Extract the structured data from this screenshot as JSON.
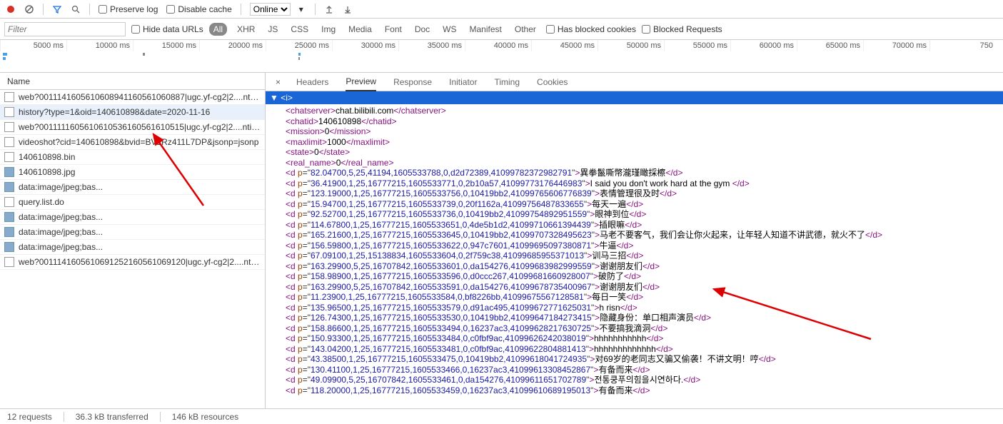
{
  "toolbar": {
    "preserve_log_label": "Preserve log",
    "disable_cache_label": "Disable cache",
    "throttle_value": "Online"
  },
  "filter": {
    "placeholder": "Filter",
    "hide_data_urls_label": "Hide data URLs",
    "all_label": "All",
    "types": [
      "XHR",
      "JS",
      "CSS",
      "Img",
      "Media",
      "Font",
      "Doc",
      "WS",
      "Manifest",
      "Other"
    ],
    "blocked_cookies_label": "Has blocked cookies",
    "blocked_requests_label": "Blocked Requests"
  },
  "timeline_ticks": [
    "5000 ms",
    "10000 ms",
    "15000 ms",
    "20000 ms",
    "25000 ms",
    "30000 ms",
    "35000 ms",
    "40000 ms",
    "45000 ms",
    "50000 ms",
    "55000 ms",
    "60000 ms",
    "65000 ms",
    "70000 ms",
    "750"
  ],
  "left_header": "Name",
  "requests": [
    {
      "name": "web?0011141605610608941160561060887|ugc.yf-cg2|2....ntin...",
      "kind": "doc"
    },
    {
      "name": "history?type=1&oid=140610898&date=2020-11-16",
      "kind": "doc",
      "selected": true
    },
    {
      "name": "web?0011111605610610536160561610515|ugc.yf-cg2|2....ntin...",
      "kind": "doc"
    },
    {
      "name": "videoshot?cid=140610898&bvid=BV1Rz411L7DP&jsonp=jsonp",
      "kind": "doc"
    },
    {
      "name": "140610898.bin",
      "kind": "doc"
    },
    {
      "name": "140610898.jpg",
      "kind": "img"
    },
    {
      "name": "data:image/jpeg;bas...",
      "kind": "img"
    },
    {
      "name": "query.list.do",
      "kind": "doc"
    },
    {
      "name": "data:image/jpeg;bas...",
      "kind": "img"
    },
    {
      "name": "data:image/jpeg;bas...",
      "kind": "img"
    },
    {
      "name": "data:image/jpeg;bas...",
      "kind": "img"
    },
    {
      "name": "web?0011141605610691252160561069120|ugc.yf-cg2|2....ntin...",
      "kind": "doc"
    }
  ],
  "tabs": [
    "Headers",
    "Preview",
    "Response",
    "Initiator",
    "Timing",
    "Cookies"
  ],
  "active_tab": 1,
  "tree_root": "<i>",
  "xml": {
    "simple": [
      {
        "tag": "chatserver",
        "text": "chat.bilibili.com"
      },
      {
        "tag": "chatid",
        "text": "140610898"
      },
      {
        "tag": "mission",
        "text": "0"
      },
      {
        "tag": "maxlimit",
        "text": "1000"
      },
      {
        "tag": "state",
        "text": "0"
      },
      {
        "tag": "real_name",
        "text": "0"
      }
    ],
    "d": [
      {
        "p": "82.04700,5,25,41194,1605533788,0,d2d72389,41099782372982791",
        "t": "異拳鬣嘶幣瀧瑾瞰採檫"
      },
      {
        "p": "36.41900,1,25,16777215,1605533771,0,2b10a57,41099773176446983",
        "t": "I said you don't work hard at the gym "
      },
      {
        "p": "123.19000,1,25,16777215,1605533756,0,10419bb2,41099765606776839",
        "t": "表情管理很及时"
      },
      {
        "p": "15.94700,1,25,16777215,1605533739,0,20f1162a,41099756487833655",
        "t": "每天一遍"
      },
      {
        "p": "92.52700,1,25,16777215,1605533736,0,10419bb2,41099754892951559",
        "t": "眼神到位"
      },
      {
        "p": "114.67800,1,25,16777215,1605533651,0,4de5b1d2,41099710661394439",
        "t": "插眼嘛"
      },
      {
        "p": "165.21600,1,25,16777215,1605533645,0,10419bb2,41099707328495623",
        "t": "马老不要客气，我们会让你火起来，让年轻人知道不讲武德，就火不了"
      },
      {
        "p": "156.59800,1,25,16777215,1605533622,0,947c7601,41099695097380871",
        "t": "牛逼"
      },
      {
        "p": "67.09100,1,25,15138834,1605533604,0,2f759c38,41099685955371013",
        "t": "训马三招"
      },
      {
        "p": "163.29900,5,25,16707842,1605533601,0,da154276,41099683982999559",
        "t": "谢谢朋友们"
      },
      {
        "p": "158.98900,1,25,16777215,1605533596,0,d0ccc267,41099681660928007",
        "t": "破防了"
      },
      {
        "p": "163.29900,5,25,16707842,1605533591,0,da154276,41099678735400967",
        "t": "谢谢朋友们"
      },
      {
        "p": "11.23900,1,25,16777215,1605533584,0,bf8226bb,41099675567128581",
        "t": "每日一笑"
      },
      {
        "p": "135.96500,1,25,16777215,1605533579,0,d91ac495,41099672771625031",
        "t": "h risn"
      },
      {
        "p": "126.74300,1,25,16777215,1605533530,0,10419bb2,41099647184273415",
        "t": "隐藏身份：单口相声演员"
      },
      {
        "p": "158.86600,1,25,16777215,1605533494,0,16237ac3,41099628217630725",
        "t": "不要搞我滴洞"
      },
      {
        "p": "150.93300,1,25,16777215,1605533484,0,c0fbf9ac,41099626242038019",
        "t": "hhhhhhhhhhh"
      },
      {
        "p": "143.04200,1,25,16777215,1605533481,0,c0fbf9ac,41099622804881413",
        "t": "hhhhhhhhhhhhh"
      },
      {
        "p": "43.38500,1,25,16777215,1605533475,0,10419bb2,41099618041724935",
        "t": "对69岁的老同志又骗又偷袭！不讲文明！哼"
      },
      {
        "p": "130.41100,1,25,16777215,1605533466,0,16237ac3,41099613308452867",
        "t": "有备而来"
      },
      {
        "p": "49.09900,5,25,16707842,1605533461,0,da154276,41099611651702789",
        "t": "전통쿵푸의힘을시연하다."
      },
      {
        "p": "118.20000,1,25,16777215,1605533459,0,16237ac3,41099610689195013",
        "t": "有备而来"
      }
    ]
  },
  "status": {
    "requests": "12 requests",
    "transferred": "36.3 kB transferred",
    "resources": "146 kB resources"
  }
}
